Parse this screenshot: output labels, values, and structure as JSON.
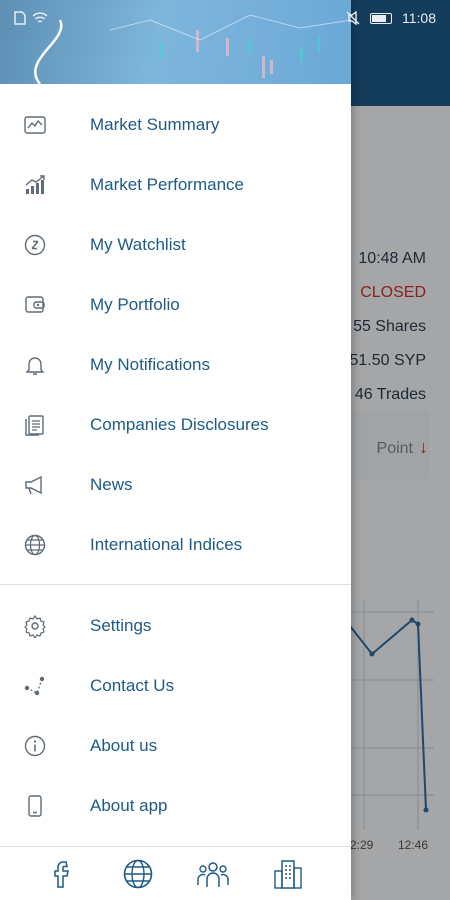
{
  "status_bar": {
    "time": "11:08"
  },
  "background": {
    "time": "10:48 AM",
    "status": "CLOSED",
    "shares": "55 Shares",
    "value": "51.50 SYP",
    "trades": "46 Trades",
    "point": "Point",
    "chart_ticks": [
      "2:29",
      "12:46"
    ]
  },
  "menu": {
    "primary": [
      {
        "label": "Market Summary",
        "icon": "chart-line-icon"
      },
      {
        "label": "Market Performance",
        "icon": "bar-chart-up-icon"
      },
      {
        "label": "My Watchlist",
        "icon": "watchlist-coin-icon"
      },
      {
        "label": "My Portfolio",
        "icon": "portfolio-wallet-icon"
      },
      {
        "label": "My Notifications",
        "icon": "bell-icon"
      },
      {
        "label": "Companies Disclosures",
        "icon": "documents-icon"
      },
      {
        "label": "News",
        "icon": "megaphone-icon"
      },
      {
        "label": "International Indices",
        "icon": "globe-icon"
      }
    ],
    "secondary": [
      {
        "label": "Settings",
        "icon": "gear-icon"
      },
      {
        "label": "Contact Us",
        "icon": "share-nodes-icon"
      },
      {
        "label": "About us",
        "icon": "info-icon"
      },
      {
        "label": "About app",
        "icon": "phone-icon"
      }
    ]
  },
  "bottom_bar": [
    "facebook-icon",
    "website-globe-icon",
    "team-icon",
    "building-icon"
  ],
  "colors": {
    "accent": "#1d5a86",
    "closed": "#d32f2f",
    "divider": "#dcdfe3"
  }
}
